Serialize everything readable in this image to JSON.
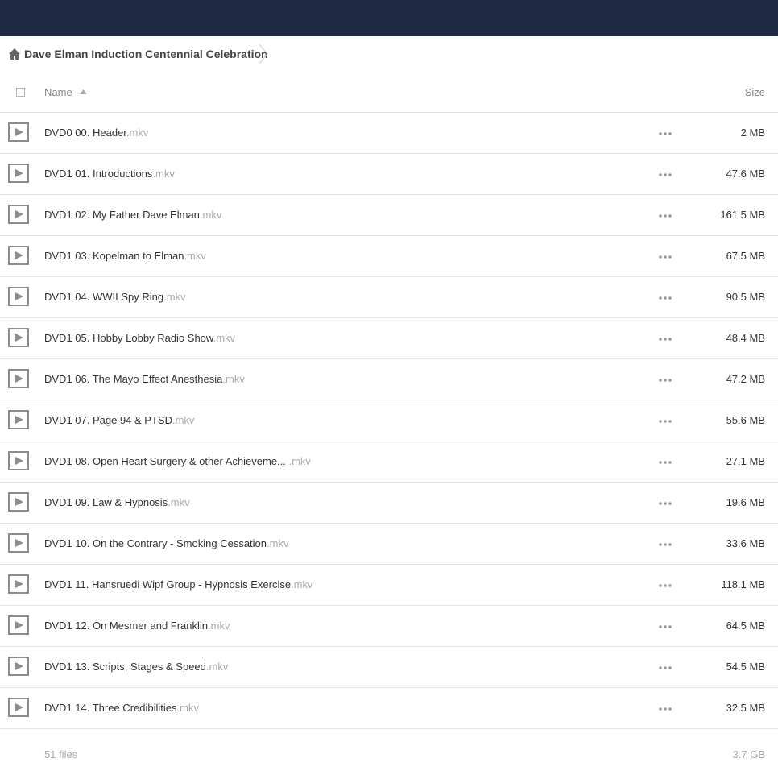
{
  "breadcrumb": {
    "folder": "Dave Elman Induction Centennial Celebration"
  },
  "header": {
    "name_label": "Name",
    "size_label": "Size"
  },
  "files": [
    {
      "name": "DVD0 00. Header",
      "ext": ".mkv",
      "size": "2 MB"
    },
    {
      "name": "DVD1 01. Introductions",
      "ext": ".mkv",
      "size": "47.6 MB"
    },
    {
      "name": "DVD1 02. My Father Dave Elman",
      "ext": ".mkv",
      "size": "161.5 MB"
    },
    {
      "name": "DVD1 03. Kopelman to Elman",
      "ext": ".mkv",
      "size": "67.5 MB"
    },
    {
      "name": "DVD1 04. WWII Spy Ring",
      "ext": ".mkv",
      "size": "90.5 MB"
    },
    {
      "name": "DVD1 05. Hobby Lobby Radio Show",
      "ext": ".mkv",
      "size": "48.4 MB"
    },
    {
      "name": "DVD1 06. The Mayo Effect Anesthesia",
      "ext": ".mkv",
      "size": "47.2 MB"
    },
    {
      "name": "DVD1 07. Page 94 & PTSD",
      "ext": ".mkv",
      "size": "55.6 MB"
    },
    {
      "name": "DVD1 08. Open Heart Surgery & other Achieveme...",
      "ext": " .mkv",
      "size": "27.1 MB"
    },
    {
      "name": "DVD1 09. Law & Hypnosis",
      "ext": ".mkv",
      "size": "19.6 MB"
    },
    {
      "name": "DVD1 10. On the Contrary - Smoking Cessation",
      "ext": ".mkv",
      "size": "33.6 MB"
    },
    {
      "name": "DVD1 11. Hansruedi Wipf Group - Hypnosis Exercise",
      "ext": ".mkv",
      "size": "118.1 MB"
    },
    {
      "name": "DVD1 12. On Mesmer and Franklin",
      "ext": ".mkv",
      "size": "64.5 MB"
    },
    {
      "name": "DVD1 13. Scripts, Stages & Speed",
      "ext": ".mkv",
      "size": "54.5 MB"
    },
    {
      "name": "DVD1 14. Three Credibilities",
      "ext": ".mkv",
      "size": "32.5 MB"
    }
  ],
  "footer": {
    "files_count": "51 files",
    "total_size": "3.7 GB"
  },
  "icons": {
    "home": "home-icon",
    "sort": "sort-ascending-icon",
    "file": "play-icon",
    "actions": "more-horizontal-icon"
  },
  "colors": {
    "topbar": "#1e2a44",
    "extension": "#aaaaaa"
  }
}
